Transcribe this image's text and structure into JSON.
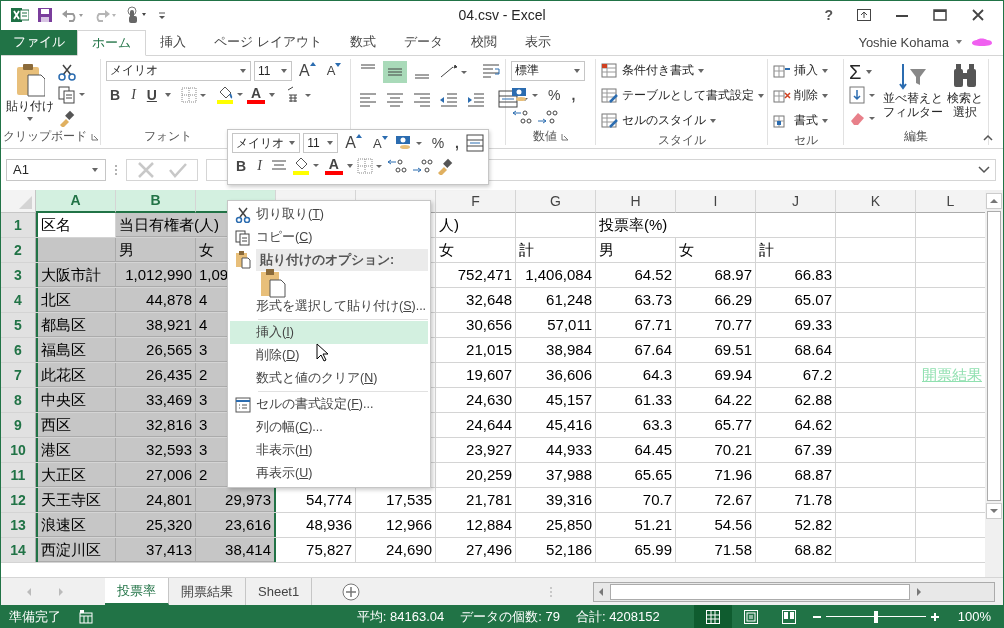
{
  "window": {
    "title": "04.csv - Excel",
    "help": "?"
  },
  "tabs": [
    {
      "label": "ファイル",
      "kind": "file",
      "selected": false
    },
    {
      "label": "ホーム",
      "kind": "tab",
      "selected": true
    },
    {
      "label": "挿入",
      "kind": "tab",
      "selected": false
    },
    {
      "label": "ページ レイアウト",
      "kind": "tab",
      "selected": false
    },
    {
      "label": "数式",
      "kind": "tab",
      "selected": false
    },
    {
      "label": "データ",
      "kind": "tab",
      "selected": false
    },
    {
      "label": "校閲",
      "kind": "tab",
      "selected": false
    },
    {
      "label": "表示",
      "kind": "tab",
      "selected": false
    }
  ],
  "user": {
    "name": "Yoshie Kohama"
  },
  "ribbon": {
    "clipboard": {
      "paste": "貼り付け",
      "label": "クリップボード"
    },
    "font": {
      "name": "メイリオ",
      "size": "11",
      "grow": "A",
      "shrink": "A",
      "bold": "B",
      "italic": "I",
      "underline": "U",
      "font_color": "A",
      "label": "フォント"
    },
    "number": {
      "format": "標準",
      "percent": "%",
      "comma": ",",
      "label": "数値"
    },
    "styles": {
      "items": [
        "条件付き書式",
        "テーブルとして書式設定",
        "セルのスタイル"
      ],
      "label": "スタイル"
    },
    "cells": {
      "items": [
        "挿入",
        "削除",
        "書式"
      ],
      "label": "セル"
    },
    "editing": {
      "sum": "Σ",
      "sort": [
        "並べ替えと",
        "フィルター"
      ],
      "find": [
        "検索と",
        "選択"
      ],
      "label": "編集"
    }
  },
  "formula_bar": {
    "name_box": "A1"
  },
  "mini_toolbar": {
    "font": "メイリオ",
    "size": "11",
    "grow": "A",
    "shrink": "A",
    "percent": "%",
    "comma": ",",
    "bold": "B",
    "italic": "I",
    "font_color": "A"
  },
  "columns": [
    {
      "label": "A",
      "selected": true
    },
    {
      "label": "B",
      "selected": true
    },
    {
      "selected": true
    },
    {
      "selected": false
    },
    {
      "selected": false
    },
    {
      "label": "F",
      "selected": false
    },
    {
      "label": "G",
      "selected": false
    },
    {
      "label": "H",
      "selected": false
    },
    {
      "label": "I",
      "selected": false
    },
    {
      "label": "J",
      "selected": false
    },
    {
      "label": "K",
      "selected": false
    },
    {
      "label": "L",
      "selected": false
    }
  ],
  "rows": [
    {
      "header": "1",
      "cells": [
        {
          "text": "区名",
          "active": true
        },
        "当日有権者(人)",
        null,
        null,
        null,
        "人)",
        null,
        "投票率(%)",
        null,
        null,
        null,
        null
      ]
    },
    {
      "header": "2",
      "cells": [
        null,
        "男",
        "女",
        null,
        null,
        "女",
        "計",
        "男",
        "女",
        "計",
        null,
        null
      ]
    },
    {
      "header": "3",
      "cells": [
        "大阪市計",
        "1,012,990",
        {
          "text": "1,09",
          "kind": "clipped"
        },
        null,
        null,
        "752,471",
        "1,406,084",
        "64.52",
        "68.97",
        "66.83",
        null,
        null
      ]
    },
    {
      "header": "4",
      "cells": [
        "北区",
        "44,878",
        {
          "text": "4",
          "kind": "clipped"
        },
        null,
        null,
        "32,648",
        "61,248",
        "63.73",
        "66.29",
        "65.07",
        null,
        null
      ]
    },
    {
      "header": "5",
      "cells": [
        "都島区",
        "38,921",
        {
          "text": "4",
          "kind": "clipped"
        },
        null,
        null,
        "30,656",
        "57,011",
        "67.71",
        "70.77",
        "69.33",
        null,
        null
      ]
    },
    {
      "header": "6",
      "cells": [
        "福島区",
        "26,565",
        {
          "text": "3",
          "kind": "clipped"
        },
        null,
        null,
        "21,015",
        "38,984",
        "67.64",
        "69.51",
        "68.64",
        null,
        null
      ]
    },
    {
      "header": "7",
      "cells": [
        "此花区",
        "26,435",
        {
          "text": "2",
          "kind": "clipped"
        },
        null,
        null,
        "19,607",
        "36,606",
        "64.3",
        "69.94",
        "67.2",
        null,
        {
          "text": "開票結果",
          "kind": "link"
        }
      ]
    },
    {
      "header": "8",
      "cells": [
        "中央区",
        "33,469",
        {
          "text": "3",
          "kind": "clipped"
        },
        null,
        null,
        "24,630",
        "45,157",
        "61.33",
        "64.22",
        "62.88",
        null,
        null
      ]
    },
    {
      "header": "9",
      "cells": [
        "西区",
        "32,816",
        {
          "text": "3",
          "kind": "clipped"
        },
        null,
        null,
        "24,644",
        "45,416",
        "63.3",
        "65.77",
        "64.62",
        null,
        null
      ]
    },
    {
      "header": "10",
      "cells": [
        "港区",
        "32,593",
        {
          "text": "3",
          "kind": "clipped"
        },
        null,
        null,
        "23,927",
        "44,933",
        "64.45",
        "70.21",
        "67.39",
        null,
        null
      ]
    },
    {
      "header": "11",
      "cells": [
        "大正区",
        "27,006",
        {
          "text": "2",
          "kind": "clipped"
        },
        null,
        null,
        "20,259",
        "37,988",
        "65.65",
        "71.96",
        "68.87",
        null,
        null
      ]
    },
    {
      "header": "12",
      "cells": [
        "天王寺区",
        "24,801",
        "29,973",
        "54,774",
        "17,535",
        "21,781",
        "39,316",
        "70.7",
        "72.67",
        "71.78",
        null,
        null
      ]
    },
    {
      "header": "13",
      "cells": [
        "浪速区",
        "25,320",
        "23,616",
        "48,936",
        "12,966",
        "12,884",
        "25,850",
        "51.21",
        "54.56",
        "52.82",
        null,
        null
      ]
    },
    {
      "header": "14",
      "cells": [
        "西淀川区",
        "37,413",
        "38,414",
        "75,827",
        "24,690",
        "27,496",
        "52,186",
        "65.99",
        "71.58",
        "68.82",
        null,
        null
      ]
    }
  ],
  "context_menu": {
    "items": [
      {
        "kind": "item",
        "before": "切り取り(",
        "key": "T",
        "after": ")",
        "selected": false
      },
      {
        "kind": "item",
        "before": "コピー(",
        "key": "C",
        "after": ")",
        "selected": false
      },
      {
        "kind": "header",
        "label": "貼り付けのオプション:"
      },
      {
        "kind": "paste"
      },
      {
        "kind": "item",
        "before": "形式を選択して貼り付け(",
        "key": "S",
        "after": ")...",
        "selected": false
      },
      {
        "kind": "separator"
      },
      {
        "kind": "item",
        "before": "挿入(",
        "key": "I",
        "after": ")",
        "selected": true
      },
      {
        "kind": "item",
        "before": "削除(",
        "key": "D",
        "after": ")",
        "selected": false
      },
      {
        "kind": "item",
        "before": "数式と値のクリア(",
        "key": "N",
        "after": ")",
        "selected": false
      },
      {
        "kind": "separator"
      },
      {
        "kind": "item",
        "before": "セルの書式設定(",
        "key": "F",
        "after": ")...",
        "selected": false
      },
      {
        "kind": "item",
        "before": "列の幅(",
        "key": "C",
        "after": ")...",
        "selected": false
      },
      {
        "kind": "item",
        "before": "非表示(",
        "key": "H",
        "after": ")",
        "selected": false
      },
      {
        "kind": "item",
        "before": "再表示(",
        "key": "U",
        "after": ")",
        "selected": false
      }
    ]
  },
  "sheet_tabs": [
    {
      "label": "投票率",
      "selected": true
    },
    {
      "label": "開票結果",
      "selected": false
    },
    {
      "label": "Sheet1",
      "selected": false
    }
  ],
  "status_bar": {
    "ready": "準備完了",
    "stats": [
      "平均: 84163.04",
      "データの個数: 79",
      "合計: 4208152"
    ],
    "views": [
      {
        "kind": "normal",
        "selected": true
      },
      {
        "kind": "layout",
        "selected": false
      },
      {
        "kind": "break",
        "selected": false
      }
    ],
    "zoom": {
      "level": 0.5,
      "reading": "100%"
    }
  }
}
